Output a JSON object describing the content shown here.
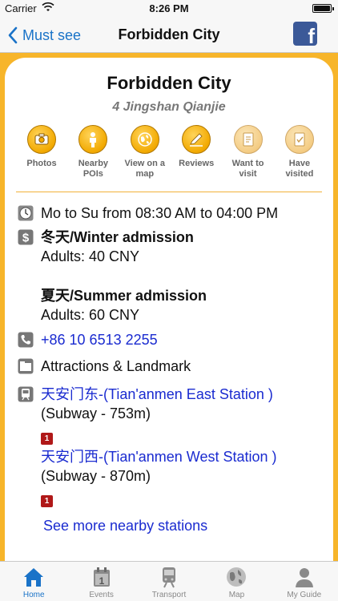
{
  "status_bar": {
    "carrier": "Carrier",
    "time": "8:26 PM"
  },
  "nav": {
    "back_label": "Must see",
    "title": "Forbidden City",
    "share_label": "f"
  },
  "place": {
    "name": "Forbidden City",
    "address": "4 Jingshan Qianjie"
  },
  "actions": [
    {
      "label": "Photos",
      "icon": "camera-icon"
    },
    {
      "label": "Nearby POIs",
      "icon": "person-icon"
    },
    {
      "label": "View on a map",
      "icon": "globe-icon"
    },
    {
      "label": "Reviews",
      "icon": "pencil-icon"
    },
    {
      "label": "Want to visit",
      "icon": "document-icon"
    },
    {
      "label": "Have visited",
      "icon": "document-check-icon"
    }
  ],
  "info": {
    "hours": "Mo to Su from 08:30 AM to 04:00 PM",
    "winter_title": "冬天/Winter admission",
    "winter_price": "Adults: 40 CNY",
    "summer_title": "夏天/Summer admission",
    "summer_price": "Adults: 60 CNY",
    "phone": "+86 10 6513 2255",
    "category": "Attractions & Landmark",
    "station1_name": "天安门东-(Tian'anmen East Station )",
    "station1_detail": "(Subway - 753m)",
    "station1_line": "1",
    "station2_name": "天安门西-(Tian'anmen West Station )",
    "station2_detail": "(Subway - 870m)",
    "station2_line": "1",
    "more_stations": "See more nearby stations"
  },
  "tabs": [
    {
      "label": "Home",
      "icon": "home-icon",
      "active": true
    },
    {
      "label": "Events",
      "icon": "calendar-icon",
      "active": false
    },
    {
      "label": "Transport",
      "icon": "train-icon",
      "active": false
    },
    {
      "label": "Map",
      "icon": "globe-icon",
      "active": false
    },
    {
      "label": "My Guide",
      "icon": "user-icon",
      "active": false
    }
  ],
  "colors": {
    "accent": "#1a73c8",
    "frame": "#f7b52a",
    "link": "#1a2bd0",
    "line_badge": "#b01818"
  }
}
